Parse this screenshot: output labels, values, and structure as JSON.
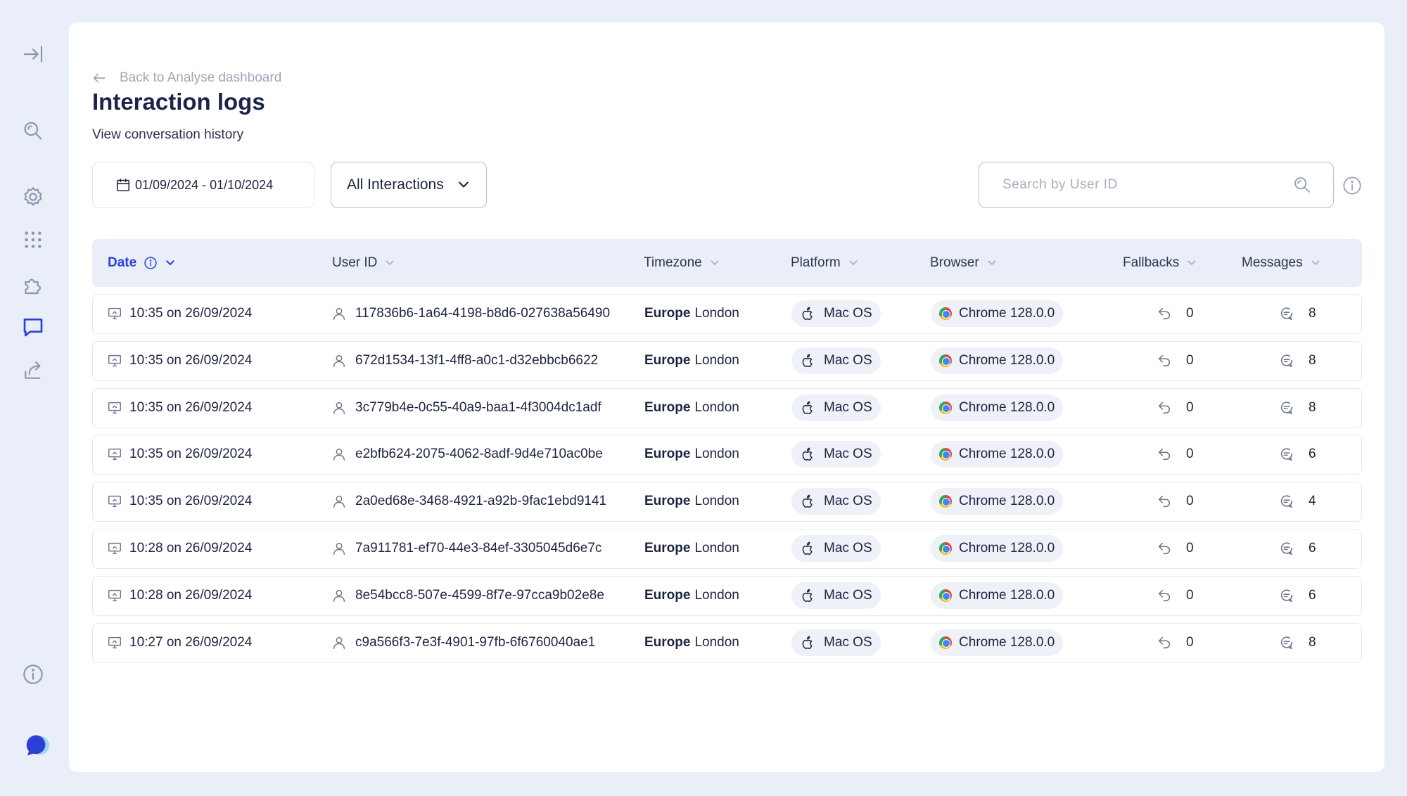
{
  "nav": {
    "back_label": "Back to Analyse dashboard"
  },
  "page": {
    "title": "Interaction logs",
    "subtitle": "View conversation history"
  },
  "filters": {
    "date_range": "01/09/2024 - 01/10/2024",
    "interaction_filter": "All Interactions",
    "search_placeholder": "Search by User ID"
  },
  "table": {
    "columns": [
      {
        "key": "date",
        "label": "Date"
      },
      {
        "key": "user_id",
        "label": "User ID"
      },
      {
        "key": "timezone",
        "label": "Timezone"
      },
      {
        "key": "platform",
        "label": "Platform"
      },
      {
        "key": "browser",
        "label": "Browser"
      },
      {
        "key": "fallbacks",
        "label": "Fallbacks"
      },
      {
        "key": "messages",
        "label": "Messages"
      }
    ],
    "rows": [
      {
        "date": "10:35 on 26/09/2024",
        "user_id": "117836b6-1a64-4198-b8d6-027638a56490",
        "tz_region": "Europe",
        "tz_city": "London",
        "platform": "Mac OS",
        "browser": "Chrome 128.0.0",
        "fallbacks": "0",
        "messages": "8"
      },
      {
        "date": "10:35 on 26/09/2024",
        "user_id": "672d1534-13f1-4ff8-a0c1-d32ebbcb6622",
        "tz_region": "Europe",
        "tz_city": "London",
        "platform": "Mac OS",
        "browser": "Chrome 128.0.0",
        "fallbacks": "0",
        "messages": "8"
      },
      {
        "date": "10:35 on 26/09/2024",
        "user_id": "3c779b4e-0c55-40a9-baa1-4f3004dc1adf",
        "tz_region": "Europe",
        "tz_city": "London",
        "platform": "Mac OS",
        "browser": "Chrome 128.0.0",
        "fallbacks": "0",
        "messages": "8"
      },
      {
        "date": "10:35 on 26/09/2024",
        "user_id": "e2bfb624-2075-4062-8adf-9d4e710ac0be",
        "tz_region": "Europe",
        "tz_city": "London",
        "platform": "Mac OS",
        "browser": "Chrome 128.0.0",
        "fallbacks": "0",
        "messages": "6"
      },
      {
        "date": "10:35 on 26/09/2024",
        "user_id": "2a0ed68e-3468-4921-a92b-9fac1ebd9141",
        "tz_region": "Europe",
        "tz_city": "London",
        "platform": "Mac OS",
        "browser": "Chrome 128.0.0",
        "fallbacks": "0",
        "messages": "4"
      },
      {
        "date": "10:28 on 26/09/2024",
        "user_id": "7a911781-ef70-44e3-84ef-3305045d6e7c",
        "tz_region": "Europe",
        "tz_city": "London",
        "platform": "Mac OS",
        "browser": "Chrome 128.0.0",
        "fallbacks": "0",
        "messages": "6"
      },
      {
        "date": "10:28 on 26/09/2024",
        "user_id": "8e54bcc8-507e-4599-8f7e-97cca9b02e8e",
        "tz_region": "Europe",
        "tz_city": "London",
        "platform": "Mac OS",
        "browser": "Chrome 128.0.0",
        "fallbacks": "0",
        "messages": "6"
      },
      {
        "date": "10:27 on 26/09/2024",
        "user_id": "c9a566f3-7e3f-4901-97fb-6f6760040ae1",
        "tz_region": "Europe",
        "tz_city": "London",
        "platform": "Mac OS",
        "browser": "Chrome 128.0.0",
        "fallbacks": "0",
        "messages": "8"
      }
    ]
  },
  "icons": {
    "sidebar": [
      "expand-sidebar-icon",
      "search-icon",
      "settings-icon",
      "grid-icon",
      "integrations-icon",
      "conversations-icon",
      "share-icon",
      "info-icon",
      "brand-logo"
    ],
    "row": [
      "monitor-icon",
      "user-icon",
      "apple-icon",
      "chrome-icon",
      "fallback-icon",
      "message-icon"
    ]
  },
  "colors": {
    "accent": "#2b3fd6",
    "background": "#e9eef8",
    "card": "#ffffff",
    "text": "#1d2440",
    "muted": "#a0a7b8"
  }
}
